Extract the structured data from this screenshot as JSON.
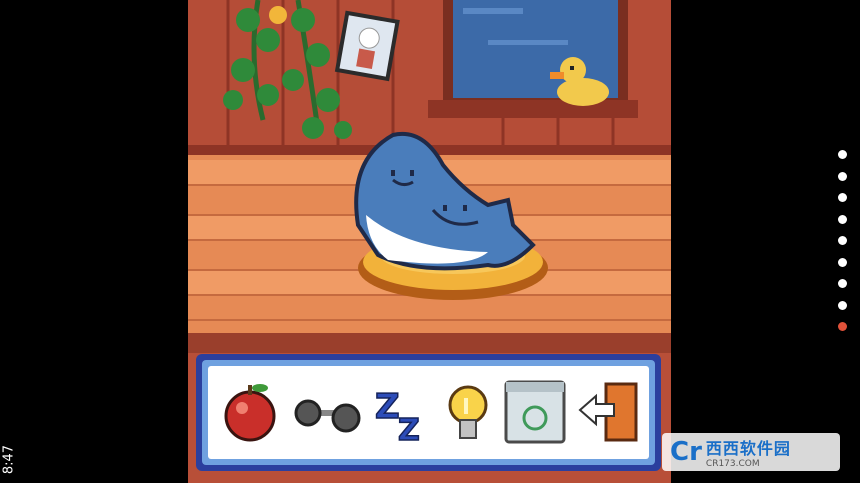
{
  "status_bar": {
    "time": "8:47"
  },
  "toolbar": {
    "items": [
      {
        "name": "feed",
        "icon": "apple-icon"
      },
      {
        "name": "exercise",
        "icon": "dumbbell-icon"
      },
      {
        "name": "sleep",
        "icon": "sleep-zz-icon"
      },
      {
        "name": "light",
        "icon": "lightbulb-icon"
      },
      {
        "name": "clean",
        "icon": "trash-can-icon"
      },
      {
        "name": "exit",
        "icon": "exit-door-icon"
      }
    ]
  },
  "pagination": {
    "count": 9,
    "active_index": 8
  },
  "watermark": {
    "logo": "Cr",
    "brand": "西西软件园",
    "url": "CR173.COM"
  },
  "colors": {
    "wall": "#b84f38",
    "floor": "#e68a55",
    "panel_border": "#2b3f9e",
    "active_dot": "#e0523a"
  }
}
